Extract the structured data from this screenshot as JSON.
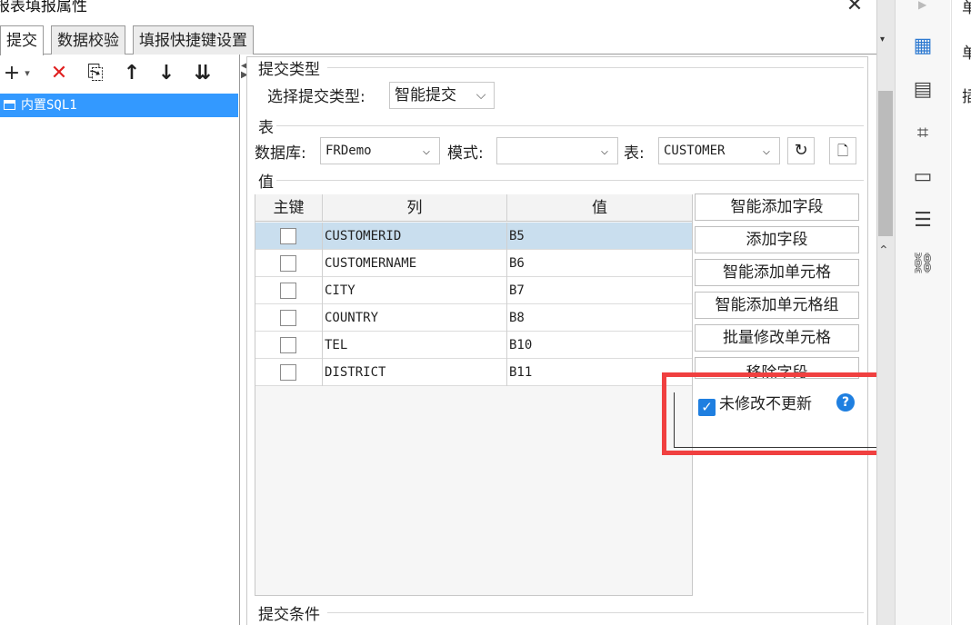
{
  "window": {
    "title": "报表填报属性",
    "close": "✕"
  },
  "tabs": [
    {
      "label": "提交"
    },
    {
      "label": "数据校验"
    },
    {
      "label": "填报快捷键设置"
    }
  ],
  "toolbar": {
    "add": "+",
    "add_caret": "▾",
    "delete": "✕",
    "copy": "⎘",
    "up": "↑",
    "down": "↓",
    "sort": "⇊"
  },
  "tree": {
    "items": [
      {
        "label": "内置SQL1"
      }
    ]
  },
  "submit_type": {
    "section": "提交类型",
    "label": "选择提交类型:",
    "value": "智能提交"
  },
  "table_section": {
    "section": "表",
    "db_label": "数据库:",
    "db_value": "FRDemo",
    "schema_label": "模式:",
    "schema_value": "",
    "table_label": "表:",
    "table_value": "CUSTOMER"
  },
  "value_section": {
    "section": "值",
    "headers": {
      "key": "主键",
      "column": "列",
      "value": "值"
    },
    "rows": [
      {
        "column": "CUSTOMERID",
        "value": "B5",
        "key": false,
        "selected": true
      },
      {
        "column": "CUSTOMERNAME",
        "value": "B6",
        "key": false,
        "selected": false
      },
      {
        "column": "CITY",
        "value": "B7",
        "key": false,
        "selected": false
      },
      {
        "column": "COUNTRY",
        "value": "B8",
        "key": false,
        "selected": false
      },
      {
        "column": "TEL",
        "value": "B10",
        "key": false,
        "selected": false
      },
      {
        "column": "DISTRICT",
        "value": "B11",
        "key": false,
        "selected": false
      }
    ]
  },
  "side_buttons": {
    "smart_add_fields": "智能添加字段",
    "add_field": "添加字段",
    "smart_add_cells": "智能添加单元格",
    "smart_add_cell_group": "智能添加单元格组",
    "batch_edit_cells": "批量修改单元格",
    "remove_field": "移除字段"
  },
  "no_update_unchanged": {
    "label": "未修改不更新",
    "checked": true,
    "help": "?"
  },
  "submit_condition": {
    "section": "提交条件"
  },
  "right_strip": {
    "text1": "单",
    "text2": "插"
  },
  "colors": {
    "accent": "#1f7fe0",
    "selection": "#3399ff",
    "highlight": "#f04040"
  }
}
